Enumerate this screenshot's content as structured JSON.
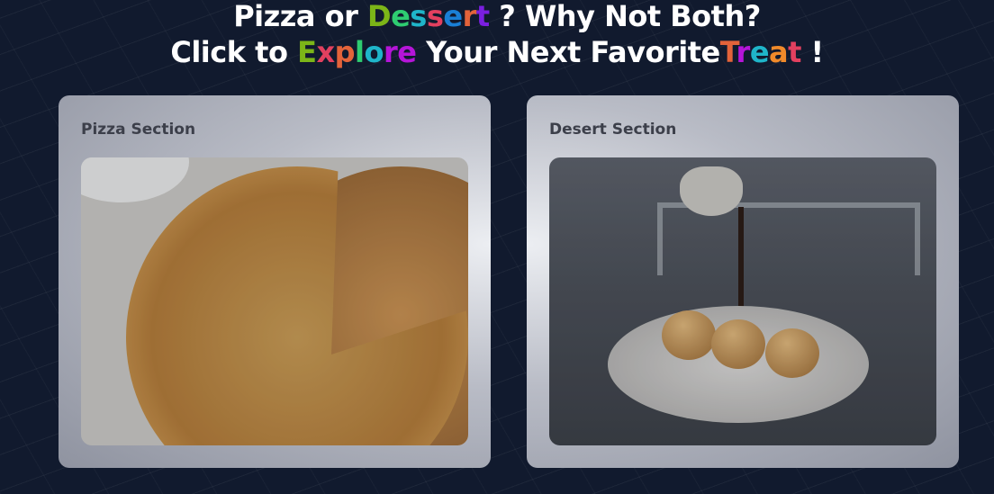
{
  "heading": {
    "line1": {
      "prefix": "Pizza or ",
      "highlight": [
        {
          "ch": "D",
          "color": "#7cb518"
        },
        {
          "ch": "e",
          "color": "#2ecc71"
        },
        {
          "ch": "s",
          "color": "#1fb5c9"
        },
        {
          "ch": "s",
          "color": "#e2405f"
        },
        {
          "ch": "e",
          "color": "#1a7fd6"
        },
        {
          "ch": "r",
          "color": "#e3633a"
        },
        {
          "ch": "t",
          "color": "#7b1fe0"
        }
      ],
      "suffix": " ? Why Not Both?"
    },
    "line2": {
      "prefix": "Click to ",
      "highlight1": [
        {
          "ch": "E",
          "color": "#7cb518"
        },
        {
          "ch": "x",
          "color": "#e2405f"
        },
        {
          "ch": "p",
          "color": "#e3633a"
        },
        {
          "ch": "l",
          "color": "#2ecc71"
        },
        {
          "ch": "o",
          "color": "#1fb5c9"
        },
        {
          "ch": "r",
          "color": "#b515d8"
        },
        {
          "ch": "e",
          "color": "#b515d8"
        }
      ],
      "middle": " Your Next Favorite",
      "highlight2": [
        {
          "ch": "T",
          "color": "#e3633a"
        },
        {
          "ch": "r",
          "color": "#b515d8"
        },
        {
          "ch": "e",
          "color": "#1fb5c9"
        },
        {
          "ch": "a",
          "color": "#f08a2a"
        },
        {
          "ch": "t",
          "color": "#e2405f"
        }
      ],
      "suffix": " !"
    }
  },
  "cards": {
    "pizza": {
      "title": "Pizza Section"
    },
    "dessert": {
      "title": "Desert Section"
    }
  }
}
